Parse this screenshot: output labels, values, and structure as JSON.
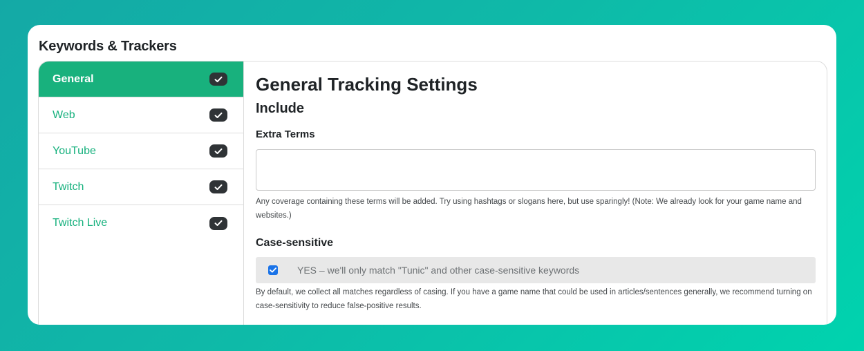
{
  "card": {
    "title": "Keywords & Trackers"
  },
  "sidebar": {
    "items": [
      {
        "label": "General",
        "active": true,
        "icon": "check-icon"
      },
      {
        "label": "Web",
        "active": false,
        "icon": "check-icon"
      },
      {
        "label": "YouTube",
        "active": false,
        "icon": "check-icon"
      },
      {
        "label": "Twitch",
        "active": false,
        "icon": "check-icon"
      },
      {
        "label": "Twitch Live",
        "active": false,
        "icon": "check-icon"
      }
    ]
  },
  "main": {
    "title": "General Tracking Settings",
    "section": "Include",
    "extra_terms": {
      "label": "Extra Terms",
      "value": "",
      "help": "Any coverage containing these terms will be added. Try using hashtags or slogans here, but use sparingly! (Note: We already look for your game name and websites.)"
    },
    "case_sensitive": {
      "label": "Case-sensitive",
      "checked": true,
      "option": "YES – we'll only match \"Tunic\" and other case-sensitive keywords",
      "help": "By default, we collect all matches regardless of casing. If you have a game name that could be used in articles/sentences generally, we recommend turning on case-sensitivity to reduce false-positive results."
    }
  },
  "colors": {
    "accent_green": "#18b17d",
    "link_green": "#14b07c",
    "checkbox_blue": "#1a73e8",
    "background_teal": "#0fb9a8"
  }
}
